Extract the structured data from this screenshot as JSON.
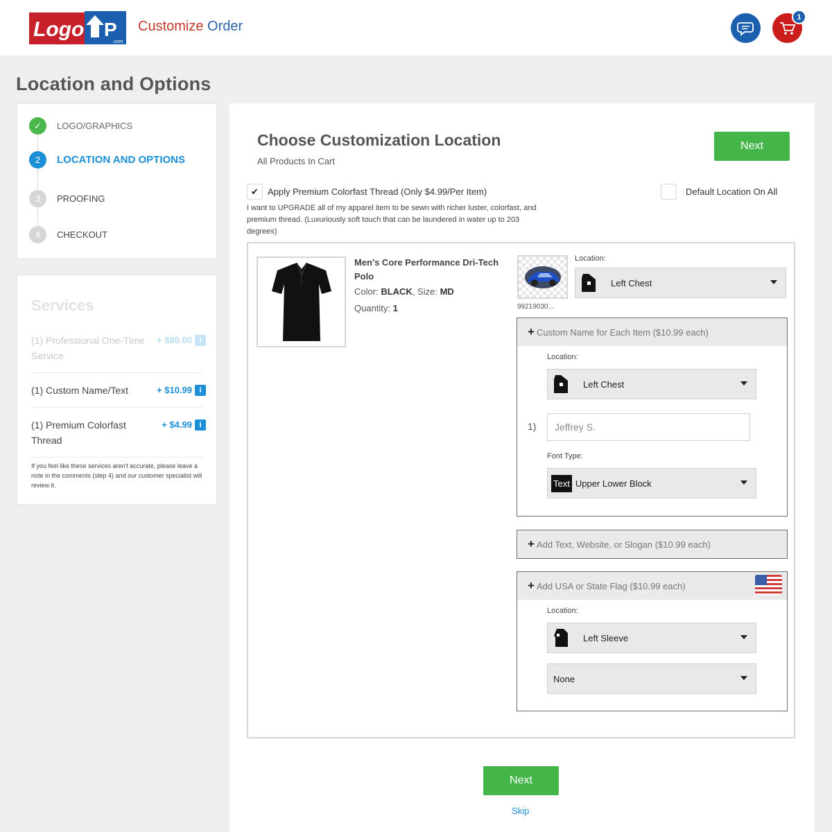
{
  "header": {
    "logo_text": "LogoUp.com",
    "title_part1": "Customize",
    "title_part2": "Order",
    "cart_count": "1"
  },
  "page_title": "Location and Options",
  "steps": [
    {
      "num": "✓",
      "label": "LOGO/GRAPHICS",
      "state": "done"
    },
    {
      "num": "2",
      "label": "LOCATION AND OPTIONS",
      "state": "active"
    },
    {
      "num": "3",
      "label": "PROOFING",
      "state": "todo"
    },
    {
      "num": "4",
      "label": "CHECKOUT",
      "state": "todo"
    }
  ],
  "services": {
    "title": "Services",
    "items": [
      {
        "name": "(1) Professional One-Time Service",
        "price": "+ $80.00",
        "info": "i"
      },
      {
        "name": "(1) Custom Name/Text",
        "price": "+ $10.99",
        "info": "i"
      },
      {
        "name": "(1) Premium Colorfast Thread",
        "price": "+ $4.99",
        "info": "i"
      }
    ],
    "note": "If you feel like these services aren't accurate, please leave a note in the comments (step 4) and our customer specialist will review it."
  },
  "main": {
    "title": "Choose Customization Location",
    "subtitle": "All Products In Cart",
    "next_label": "Next",
    "premium_thread_label": "Apply Premium Colorfast Thread (Only $4.99/Per Item)",
    "premium_thread_checked": true,
    "default_location_label": "Default Location On All",
    "upgrade_note": "I want to UPGRADE all of my apparel item to be sewn with richer luster, colorfast, and premium thread. (Luxuriously soft touch that can be laundered in water up to 203 degrees)",
    "product": {
      "name": "Men's Core Performance Dri-Tech Polo",
      "color_label": "Color:",
      "color": "BLACK",
      "size_label": "Size:",
      "size": "MD",
      "quantity_label": "Quantity:",
      "quantity": "1",
      "logo_caption": "99219030...",
      "location_label": "Location:",
      "location": "Left Chest"
    },
    "custom_name": {
      "header": "Custom Name for Each Item ($10.99 each)",
      "location_label": "Location:",
      "location": "Left Chest",
      "row_num": "1)",
      "name_placeholder": "Jeffrey S.",
      "font_type_label": "Font Type:",
      "font_icon_text": "Text",
      "font_type": "Upper Lower Block"
    },
    "add_text": {
      "header": "Add Text, Website, or Slogan ($10.99 each)"
    },
    "flag": {
      "header": "Add USA or State Flag ($10.99 each)",
      "location_label": "Location:",
      "location": "Left Sleeve",
      "flag_choice": "None"
    },
    "bottom_next_label": "Next",
    "skip_label": "Skip"
  },
  "colors": {
    "accent_blue": "#1a8fd6",
    "green": "#44b549",
    "brand_red": "#cc1d1d",
    "brand_blue": "#1b5fae"
  }
}
